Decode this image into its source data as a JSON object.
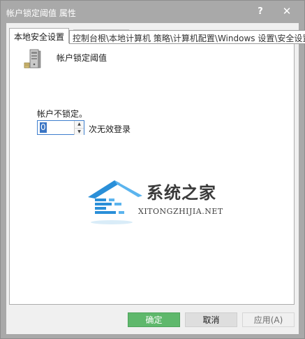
{
  "window": {
    "title": "帐户锁定阈值 属性",
    "help_glyph": "?",
    "close_glyph": "✕"
  },
  "tab": {
    "label": "本地安全设置"
  },
  "path_tooltip": "控制台根\\本地计算机 策略\\计算机配置\\Windows 设置\\安全设置",
  "policy": {
    "name": "帐户锁定阈值",
    "icon": "server-policy-icon"
  },
  "lockout": {
    "label": "帐户不锁定。",
    "value": "0",
    "unit_label": "次无效登录"
  },
  "watermark": {
    "name_cn": "系统之家",
    "name_en": "XITONGZHIJIA.NET",
    "logo": "house-logo-icon",
    "color": "#2a8fd8"
  },
  "buttons": {
    "ok": "确定",
    "cancel": "取消",
    "apply": "应用(A)"
  },
  "colors": {
    "titlebar": "#a9a9a9",
    "ok_button": "#5fb86c",
    "selection": "#3a75c4"
  }
}
